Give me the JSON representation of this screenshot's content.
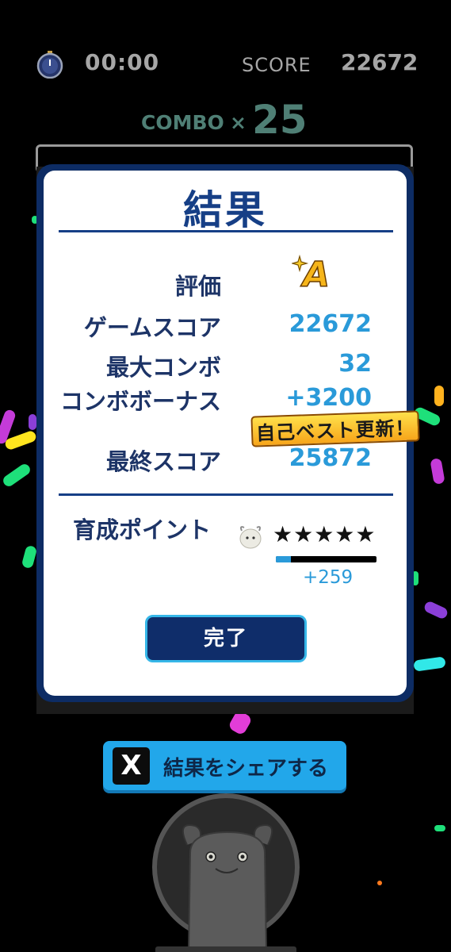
{
  "hud": {
    "timer": "00:00",
    "score_label": "SCORE",
    "score_value": "22672",
    "combo_label": "COMBO",
    "combo_x": "×",
    "combo_value": "25"
  },
  "result": {
    "title": "結果",
    "rank_label": "評価",
    "rank_value": "A",
    "game_score_label": "ゲームスコア",
    "game_score_value": "22672",
    "max_combo_label": "最大コンボ",
    "max_combo_value": "32",
    "combo_bonus_label": "コンボボーナス",
    "combo_bonus_value": "+3200",
    "best_badge": "自己ベスト更新！",
    "final_score_label": "最終スコア",
    "final_score_value": "25872",
    "training_label": "育成ポイント",
    "training_stars": "★★★★★",
    "training_star_count": 5,
    "training_progress": 0.15,
    "training_gain": "+259",
    "done_button": "完了"
  },
  "share": {
    "icon_glyph": "X",
    "label": "結果をシェアする"
  },
  "colors": {
    "modal_border": "#0d2c64",
    "label_text": "#1d3467",
    "value_text": "#2a9ad9",
    "share_button": "#22a7ea",
    "combo_text": "#4f7f75"
  }
}
